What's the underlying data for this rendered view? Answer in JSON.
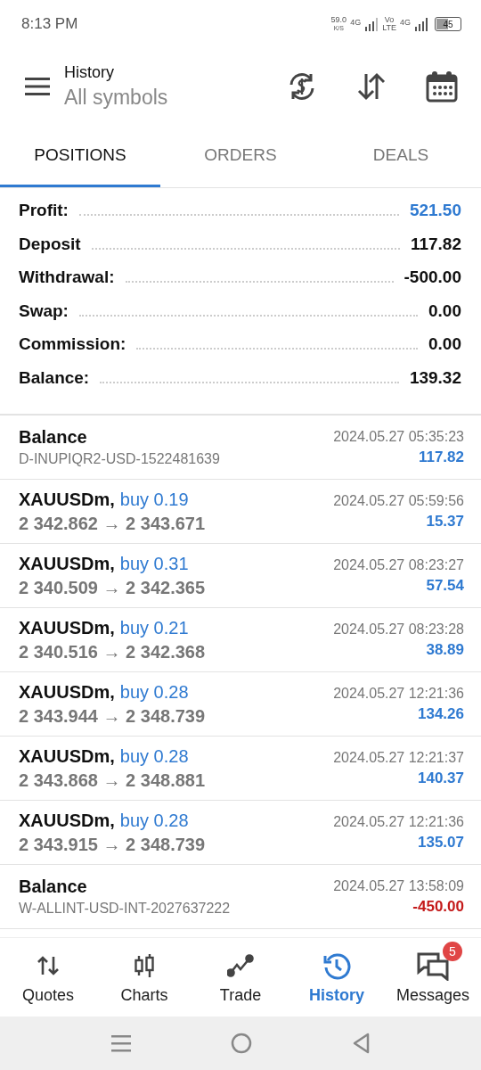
{
  "status_bar": {
    "time": "8:13 PM",
    "speed": "59.0",
    "speed_unit": "K/S",
    "net1": "4G",
    "volte_top": "Vo",
    "volte_bottom": "LTE",
    "net2": "4G",
    "battery": "45"
  },
  "header": {
    "title": "History",
    "subtitle": "All symbols"
  },
  "tabs": [
    {
      "label": "POSITIONS",
      "selected": true
    },
    {
      "label": "ORDERS",
      "selected": false
    },
    {
      "label": "DEALS",
      "selected": false
    }
  ],
  "summary": [
    {
      "label": "Profit:",
      "value": "521.50",
      "highlight": true
    },
    {
      "label": "Deposit",
      "value": "117.82",
      "highlight": false
    },
    {
      "label": "Withdrawal:",
      "value": "-500.00",
      "highlight": false
    },
    {
      "label": "Swap:",
      "value": "0.00",
      "highlight": false
    },
    {
      "label": "Commission:",
      "value": "0.00",
      "highlight": false
    },
    {
      "label": "Balance:",
      "value": "139.32",
      "highlight": false
    }
  ],
  "deals": [
    {
      "kind": "balance",
      "title": "Balance",
      "detail": "D-INUPIQR2-USD-1522481639",
      "time": "2024.05.27 05:35:23",
      "amount": "117.82",
      "negative": false
    },
    {
      "kind": "trade",
      "symbol": "XAUUSDm,",
      "side": "buy 0.19",
      "open": "2 342.862",
      "arrow": "→",
      "close": "2 343.671",
      "time": "2024.05.27 05:59:56",
      "amount": "15.37",
      "negative": false
    },
    {
      "kind": "trade",
      "symbol": "XAUUSDm,",
      "side": "buy 0.31",
      "open": "2 340.509",
      "arrow": "→",
      "close": "2 342.365",
      "time": "2024.05.27 08:23:27",
      "amount": "57.54",
      "negative": false
    },
    {
      "kind": "trade",
      "symbol": "XAUUSDm,",
      "side": "buy 0.21",
      "open": "2 340.516",
      "arrow": "→",
      "close": "2 342.368",
      "time": "2024.05.27 08:23:28",
      "amount": "38.89",
      "negative": false
    },
    {
      "kind": "trade",
      "symbol": "XAUUSDm,",
      "side": "buy 0.28",
      "open": "2 343.944",
      "arrow": "→",
      "close": "2 348.739",
      "time": "2024.05.27 12:21:36",
      "amount": "134.26",
      "negative": false
    },
    {
      "kind": "trade",
      "symbol": "XAUUSDm,",
      "side": "buy 0.28",
      "open": "2 343.868",
      "arrow": "→",
      "close": "2 348.881",
      "time": "2024.05.27 12:21:37",
      "amount": "140.37",
      "negative": false
    },
    {
      "kind": "trade",
      "symbol": "XAUUSDm,",
      "side": "buy 0.28",
      "open": "2 343.915",
      "arrow": "→",
      "close": "2 348.739",
      "time": "2024.05.27 12:21:36",
      "amount": "135.07",
      "negative": false
    },
    {
      "kind": "balance",
      "title": "Balance",
      "detail": "W-ALLINT-USD-INT-2027637222",
      "time": "2024.05.27 13:58:09",
      "amount": "-450.00",
      "negative": true
    }
  ],
  "nav": [
    {
      "kind": "quotes",
      "label": "Quotes",
      "selected": false
    },
    {
      "kind": "charts",
      "label": "Charts",
      "selected": false
    },
    {
      "kind": "trade",
      "label": "Trade",
      "selected": false
    },
    {
      "kind": "history",
      "label": "History",
      "selected": true
    },
    {
      "kind": "messages",
      "label": "Messages",
      "selected": false,
      "badge": "5"
    }
  ]
}
